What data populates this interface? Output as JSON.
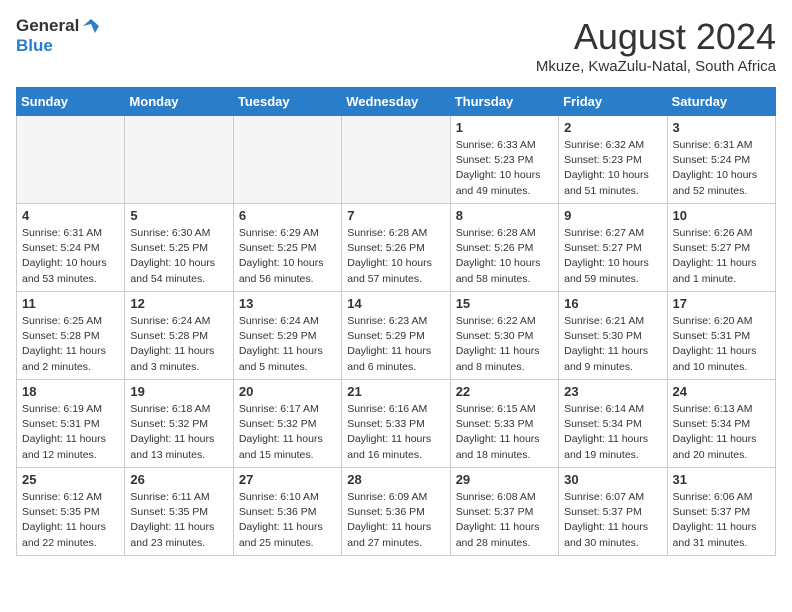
{
  "logo": {
    "general": "General",
    "blue": "Blue"
  },
  "title": "August 2024",
  "location": "Mkuze, KwaZulu-Natal, South Africa",
  "headers": [
    "Sunday",
    "Monday",
    "Tuesday",
    "Wednesday",
    "Thursday",
    "Friday",
    "Saturday"
  ],
  "weeks": [
    [
      {
        "day": "",
        "info": ""
      },
      {
        "day": "",
        "info": ""
      },
      {
        "day": "",
        "info": ""
      },
      {
        "day": "",
        "info": ""
      },
      {
        "day": "1",
        "info": "Sunrise: 6:33 AM\nSunset: 5:23 PM\nDaylight: 10 hours\nand 49 minutes."
      },
      {
        "day": "2",
        "info": "Sunrise: 6:32 AM\nSunset: 5:23 PM\nDaylight: 10 hours\nand 51 minutes."
      },
      {
        "day": "3",
        "info": "Sunrise: 6:31 AM\nSunset: 5:24 PM\nDaylight: 10 hours\nand 52 minutes."
      }
    ],
    [
      {
        "day": "4",
        "info": "Sunrise: 6:31 AM\nSunset: 5:24 PM\nDaylight: 10 hours\nand 53 minutes."
      },
      {
        "day": "5",
        "info": "Sunrise: 6:30 AM\nSunset: 5:25 PM\nDaylight: 10 hours\nand 54 minutes."
      },
      {
        "day": "6",
        "info": "Sunrise: 6:29 AM\nSunset: 5:25 PM\nDaylight: 10 hours\nand 56 minutes."
      },
      {
        "day": "7",
        "info": "Sunrise: 6:28 AM\nSunset: 5:26 PM\nDaylight: 10 hours\nand 57 minutes."
      },
      {
        "day": "8",
        "info": "Sunrise: 6:28 AM\nSunset: 5:26 PM\nDaylight: 10 hours\nand 58 minutes."
      },
      {
        "day": "9",
        "info": "Sunrise: 6:27 AM\nSunset: 5:27 PM\nDaylight: 10 hours\nand 59 minutes."
      },
      {
        "day": "10",
        "info": "Sunrise: 6:26 AM\nSunset: 5:27 PM\nDaylight: 11 hours\nand 1 minute."
      }
    ],
    [
      {
        "day": "11",
        "info": "Sunrise: 6:25 AM\nSunset: 5:28 PM\nDaylight: 11 hours\nand 2 minutes."
      },
      {
        "day": "12",
        "info": "Sunrise: 6:24 AM\nSunset: 5:28 PM\nDaylight: 11 hours\nand 3 minutes."
      },
      {
        "day": "13",
        "info": "Sunrise: 6:24 AM\nSunset: 5:29 PM\nDaylight: 11 hours\nand 5 minutes."
      },
      {
        "day": "14",
        "info": "Sunrise: 6:23 AM\nSunset: 5:29 PM\nDaylight: 11 hours\nand 6 minutes."
      },
      {
        "day": "15",
        "info": "Sunrise: 6:22 AM\nSunset: 5:30 PM\nDaylight: 11 hours\nand 8 minutes."
      },
      {
        "day": "16",
        "info": "Sunrise: 6:21 AM\nSunset: 5:30 PM\nDaylight: 11 hours\nand 9 minutes."
      },
      {
        "day": "17",
        "info": "Sunrise: 6:20 AM\nSunset: 5:31 PM\nDaylight: 11 hours\nand 10 minutes."
      }
    ],
    [
      {
        "day": "18",
        "info": "Sunrise: 6:19 AM\nSunset: 5:31 PM\nDaylight: 11 hours\nand 12 minutes."
      },
      {
        "day": "19",
        "info": "Sunrise: 6:18 AM\nSunset: 5:32 PM\nDaylight: 11 hours\nand 13 minutes."
      },
      {
        "day": "20",
        "info": "Sunrise: 6:17 AM\nSunset: 5:32 PM\nDaylight: 11 hours\nand 15 minutes."
      },
      {
        "day": "21",
        "info": "Sunrise: 6:16 AM\nSunset: 5:33 PM\nDaylight: 11 hours\nand 16 minutes."
      },
      {
        "day": "22",
        "info": "Sunrise: 6:15 AM\nSunset: 5:33 PM\nDaylight: 11 hours\nand 18 minutes."
      },
      {
        "day": "23",
        "info": "Sunrise: 6:14 AM\nSunset: 5:34 PM\nDaylight: 11 hours\nand 19 minutes."
      },
      {
        "day": "24",
        "info": "Sunrise: 6:13 AM\nSunset: 5:34 PM\nDaylight: 11 hours\nand 20 minutes."
      }
    ],
    [
      {
        "day": "25",
        "info": "Sunrise: 6:12 AM\nSunset: 5:35 PM\nDaylight: 11 hours\nand 22 minutes."
      },
      {
        "day": "26",
        "info": "Sunrise: 6:11 AM\nSunset: 5:35 PM\nDaylight: 11 hours\nand 23 minutes."
      },
      {
        "day": "27",
        "info": "Sunrise: 6:10 AM\nSunset: 5:36 PM\nDaylight: 11 hours\nand 25 minutes."
      },
      {
        "day": "28",
        "info": "Sunrise: 6:09 AM\nSunset: 5:36 PM\nDaylight: 11 hours\nand 27 minutes."
      },
      {
        "day": "29",
        "info": "Sunrise: 6:08 AM\nSunset: 5:37 PM\nDaylight: 11 hours\nand 28 minutes."
      },
      {
        "day": "30",
        "info": "Sunrise: 6:07 AM\nSunset: 5:37 PM\nDaylight: 11 hours\nand 30 minutes."
      },
      {
        "day": "31",
        "info": "Sunrise: 6:06 AM\nSunset: 5:37 PM\nDaylight: 11 hours\nand 31 minutes."
      }
    ]
  ]
}
